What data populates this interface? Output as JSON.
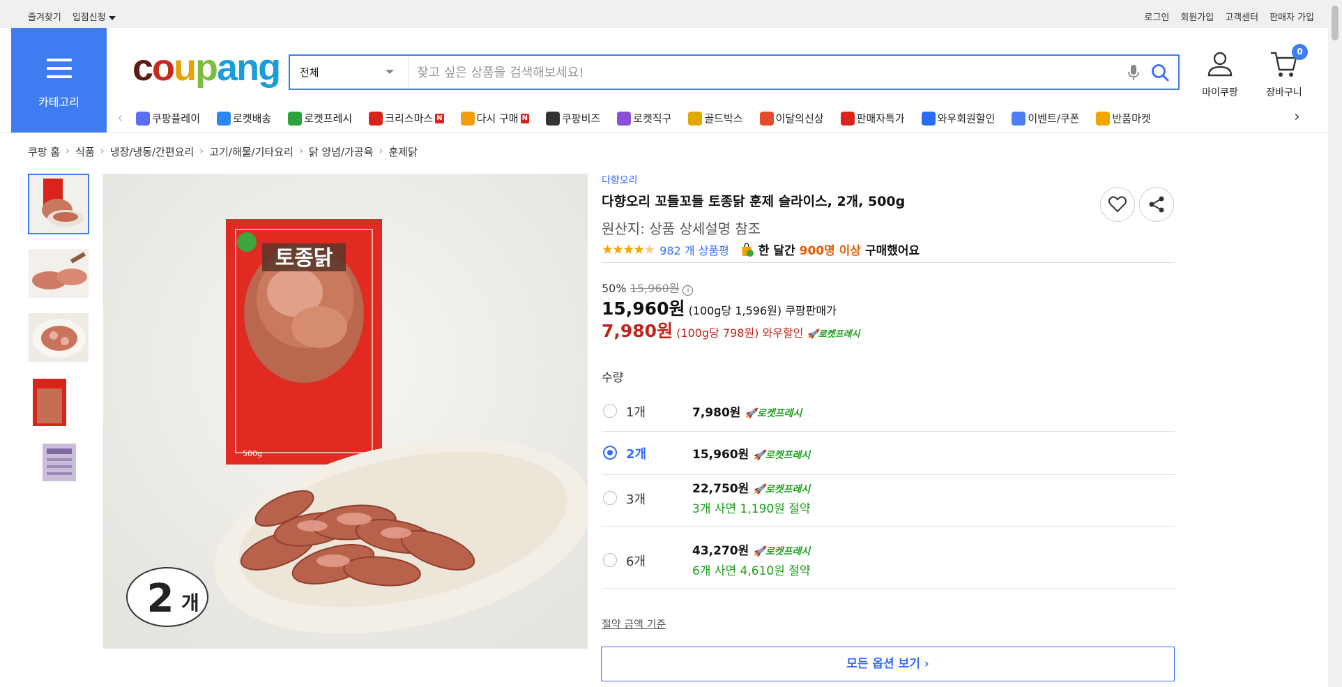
{
  "topbar": {
    "bookmark": "즐겨찾기",
    "partner": "입점신청",
    "login": "로그인",
    "signup": "회원가입",
    "support": "고객센터",
    "seller_signup": "판매자 가입"
  },
  "header": {
    "category_label": "카테고리",
    "logo_parts": [
      "c",
      "o",
      "u",
      "p",
      "ang"
    ],
    "search_category": "전체",
    "search_placeholder": "찾고 싶은 상품을 검색해보세요!",
    "mypage_label": "마이쿠팡",
    "cart_label": "장바구니",
    "cart_count": "0",
    "colors": {
      "accent": "#3f7cf1",
      "link": "#346aff",
      "sale": "#c0231b",
      "rocketfresh": "#1b9e1b"
    }
  },
  "nav": {
    "items": [
      {
        "label": "쿠팡플레이",
        "icon": "play-icon",
        "badge": ""
      },
      {
        "label": "로켓배송",
        "icon": "rocket-icon",
        "badge": ""
      },
      {
        "label": "로켓프레시",
        "icon": "rocket-fresh-icon",
        "badge": ""
      },
      {
        "label": "크리스마스",
        "icon": "santa-icon",
        "badge": "N"
      },
      {
        "label": "다시 구매",
        "icon": "bag-icon",
        "badge": "N"
      },
      {
        "label": "쿠팡비즈",
        "icon": "biz-icon",
        "badge": ""
      },
      {
        "label": "로켓직구",
        "icon": "globe-rocket-icon",
        "badge": ""
      },
      {
        "label": "골드박스",
        "icon": "goldbox-icon",
        "badge": ""
      },
      {
        "label": "이달의신상",
        "icon": "new-bag-icon",
        "badge": ""
      },
      {
        "label": "판매자특가",
        "icon": "percent-icon",
        "badge": ""
      },
      {
        "label": "와우회원할인",
        "icon": "wow-icon",
        "badge": ""
      },
      {
        "label": "이벤트/쿠폰",
        "icon": "coupon-icon",
        "badge": ""
      },
      {
        "label": "반품마켓",
        "icon": "market-icon",
        "badge": ""
      }
    ]
  },
  "breadcrumb": [
    "쿠팡 홈",
    "식품",
    "냉장/냉동/간편요리",
    "고기/해물/기타요리",
    "닭 양념/가공육",
    "훈제닭"
  ],
  "product": {
    "brand": "다향오리",
    "title": "다향오리 꼬들꼬들 토종닭 훈제 슬라이스, 2개, 500g",
    "origin": "원산지: 상품 상세설명 참조",
    "rating": 4.5,
    "review_text": "982 개 상품평",
    "bought_prefix": "한 달간",
    "bought_count": "900명 이상",
    "bought_suffix": "구매했어요",
    "image_badge_number": "2",
    "image_badge_unit": "개",
    "package_text": "토종닭",
    "package_weight": "500g"
  },
  "price": {
    "discount_rate": "50%",
    "original_price": "15,960원",
    "sale_price": "15,960원",
    "sale_unit": "(100g당 1,596원)",
    "sale_seller": "쿠팡판매가",
    "wow_price": "7,980원",
    "wow_unit": "(100g당 798원)",
    "wow_label": "와우할인",
    "rocket_fresh": "로켓프레시"
  },
  "quantity": {
    "label": "수량",
    "options": [
      {
        "qty": "1개",
        "price": "7,980원",
        "tag": "로켓프레시",
        "save": "",
        "selected": false
      },
      {
        "qty": "2개",
        "price": "15,960원",
        "tag": "로켓프레시",
        "save": "",
        "selected": true
      },
      {
        "qty": "3개",
        "price": "22,750원",
        "tag": "로켓프레시",
        "save": "3개 사면 1,190원 절약",
        "selected": false
      },
      {
        "qty": "6개",
        "price": "43,270원",
        "tag": "로켓프레시",
        "save": "6개 사면 4,610원 절약",
        "selected": false
      }
    ],
    "save_basis": "절약 금액 기준",
    "all_options": "모든 옵션 보기 ›"
  }
}
